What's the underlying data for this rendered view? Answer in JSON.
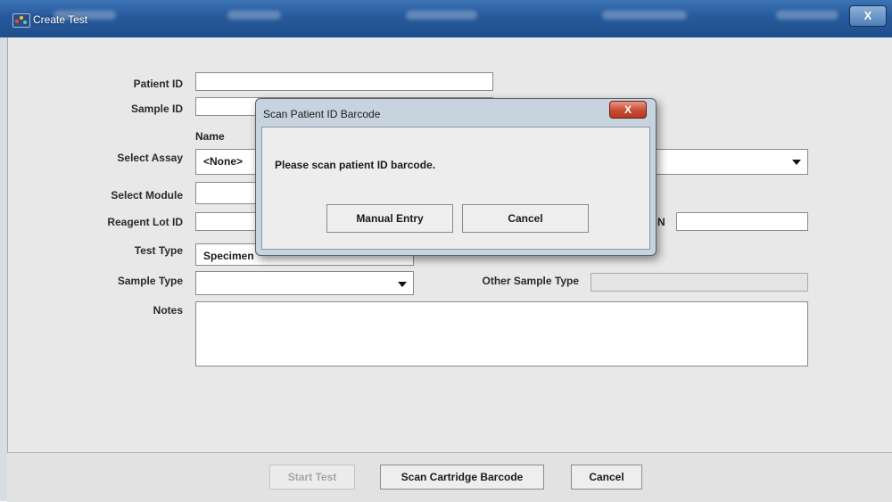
{
  "window": {
    "title": "Create Test",
    "close_glyph": "X"
  },
  "form": {
    "patient_id_label": "Patient ID",
    "patient_id_value": "",
    "sample_id_label": "Sample ID",
    "sample_id_value": "",
    "name_header": "Name",
    "select_assay_label": "Select Assay",
    "select_assay_value": "<None>",
    "select_module_label": "Select Module",
    "reagent_lot_label": "Reagent Lot ID",
    "reagent_lot_value": "",
    "partial_label_suffix": "N",
    "test_type_label": "Test Type",
    "test_type_value": "Specimen",
    "sample_type_label": "Sample Type",
    "sample_type_value": "",
    "other_sample_type_label": "Other Sample Type",
    "other_sample_type_value": "",
    "notes_label": "Notes",
    "notes_value": ""
  },
  "footer": {
    "start_test": "Start Test",
    "scan_cartridge": "Scan Cartridge Barcode",
    "cancel": "Cancel"
  },
  "dialog": {
    "title": "Scan Patient ID Barcode",
    "close_glyph": "X",
    "message": "Please scan patient ID barcode.",
    "manual_entry": "Manual Entry",
    "cancel": "Cancel"
  },
  "colors": {
    "titlebar": "#27599b",
    "dialog_close": "#c94a31",
    "content_bg": "#e8e8e8"
  }
}
